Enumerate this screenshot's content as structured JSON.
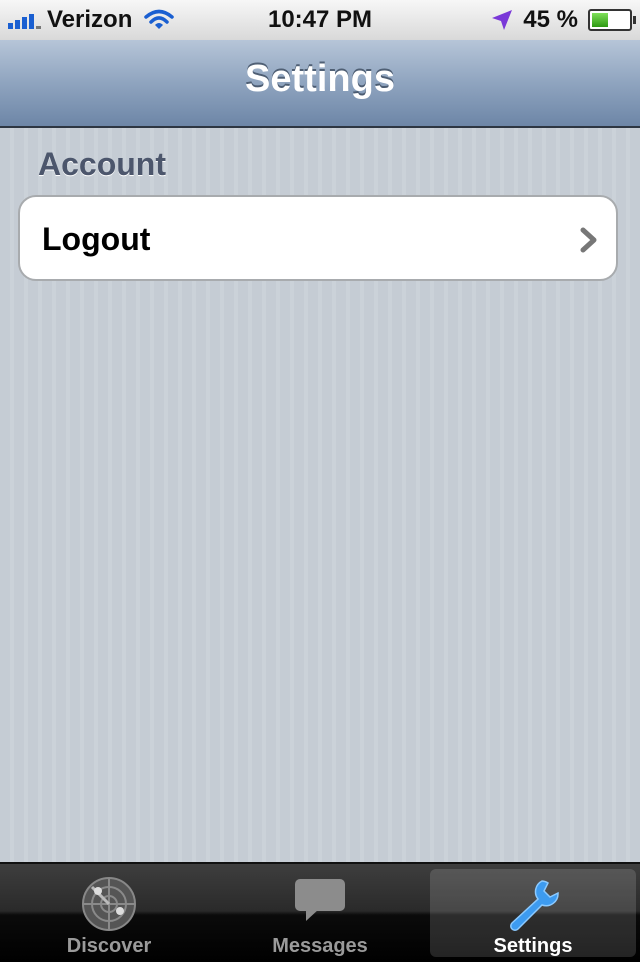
{
  "status_bar": {
    "carrier": "Verizon",
    "time": "10:47 PM",
    "battery_percent": "45 %",
    "battery_level": 0.45
  },
  "nav": {
    "title": "Settings"
  },
  "section": {
    "header": "Account",
    "rows": [
      {
        "label": "Logout"
      }
    ]
  },
  "tabs": [
    {
      "label": "Discover",
      "icon": "radar-icon",
      "selected": false
    },
    {
      "label": "Messages",
      "icon": "chat-bubble-icon",
      "selected": false
    },
    {
      "label": "Settings",
      "icon": "wrench-icon",
      "selected": true
    }
  ],
  "colors": {
    "nav_gradient_top": "#b6c5d8",
    "nav_gradient_bottom": "#6d86a7",
    "background": "#c5ccd4",
    "section_header": "#4c566c",
    "selected_tab_icon": "#3d9bf0"
  }
}
